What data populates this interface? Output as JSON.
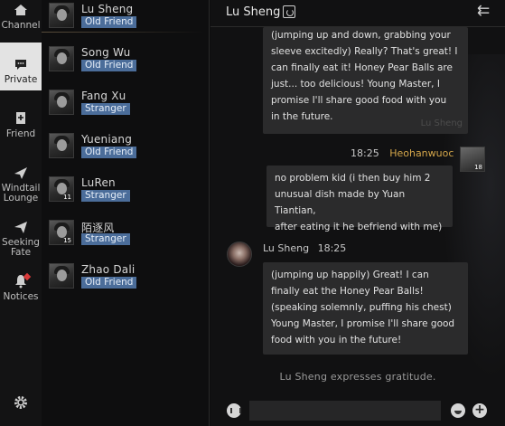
{
  "nav": {
    "items": [
      {
        "label": "Channel",
        "icon": "house-icon"
      },
      {
        "label": "Private",
        "icon": "chat-bubble-icon",
        "active": true
      },
      {
        "label": "Friend",
        "icon": "add-friend-icon"
      },
      {
        "label": "Windtail Lounge",
        "icon": "paper-plane-icon"
      },
      {
        "label": "Seeking Fate",
        "icon": "send-arrow-icon"
      },
      {
        "label": "Notices",
        "icon": "bell-icon",
        "has_alert": true
      }
    ],
    "settings_icon": "gear-icon"
  },
  "contacts": [
    {
      "name": "Lu Sheng",
      "relation": "Old Friend"
    },
    {
      "name": "Song Wu",
      "relation": "Old Friend"
    },
    {
      "name": "Fang Xu",
      "relation": "Stranger"
    },
    {
      "name": "Yueniang",
      "relation": "Old Friend"
    },
    {
      "name": "LuRen",
      "relation": "Stranger",
      "level": "11"
    },
    {
      "name": "陌逐风",
      "relation": "Stranger",
      "level": "15"
    },
    {
      "name": "Zhao Dali",
      "relation": "Old Friend"
    }
  ],
  "chat": {
    "title": "Lu Sheng",
    "messages": [
      {
        "sender": "Lu Sheng",
        "lines": [
          "(jumping up and down, grabbing your",
          "sleeve excitedly) Really? That's great! I",
          "can finally eat it! Honey Pear Balls are",
          "just... too delicious! Young Master, I",
          "promise I'll share good food with you",
          "in the future."
        ],
        "watermark": "Lu Sheng"
      },
      {
        "sender": "Heohanwuoc",
        "time": "18:25",
        "level": "18",
        "lines": [
          "no problem kid (i then buy him 2",
          "unusual dish made by Yuan Tiantian,",
          "after eating it he befriend with me)"
        ]
      },
      {
        "sender": "Lu Sheng",
        "time": "18:25",
        "lines": [
          "(jumping up happily) Great! I can",
          "finally eat the Honey Pear Balls!",
          "(speaking solemnly, puffing his chest)",
          "Young Master, I promise I'll share good",
          "food with you in the future!"
        ]
      }
    ],
    "system_message": "Lu Sheng expresses gratitude.",
    "input_value": ""
  },
  "colors": {
    "badge_bg": "#4b6d9a",
    "self_name": "#d4a64a",
    "bubble_bg": "#2b2b2c",
    "active_nav_bg": "#e3e3e3"
  }
}
